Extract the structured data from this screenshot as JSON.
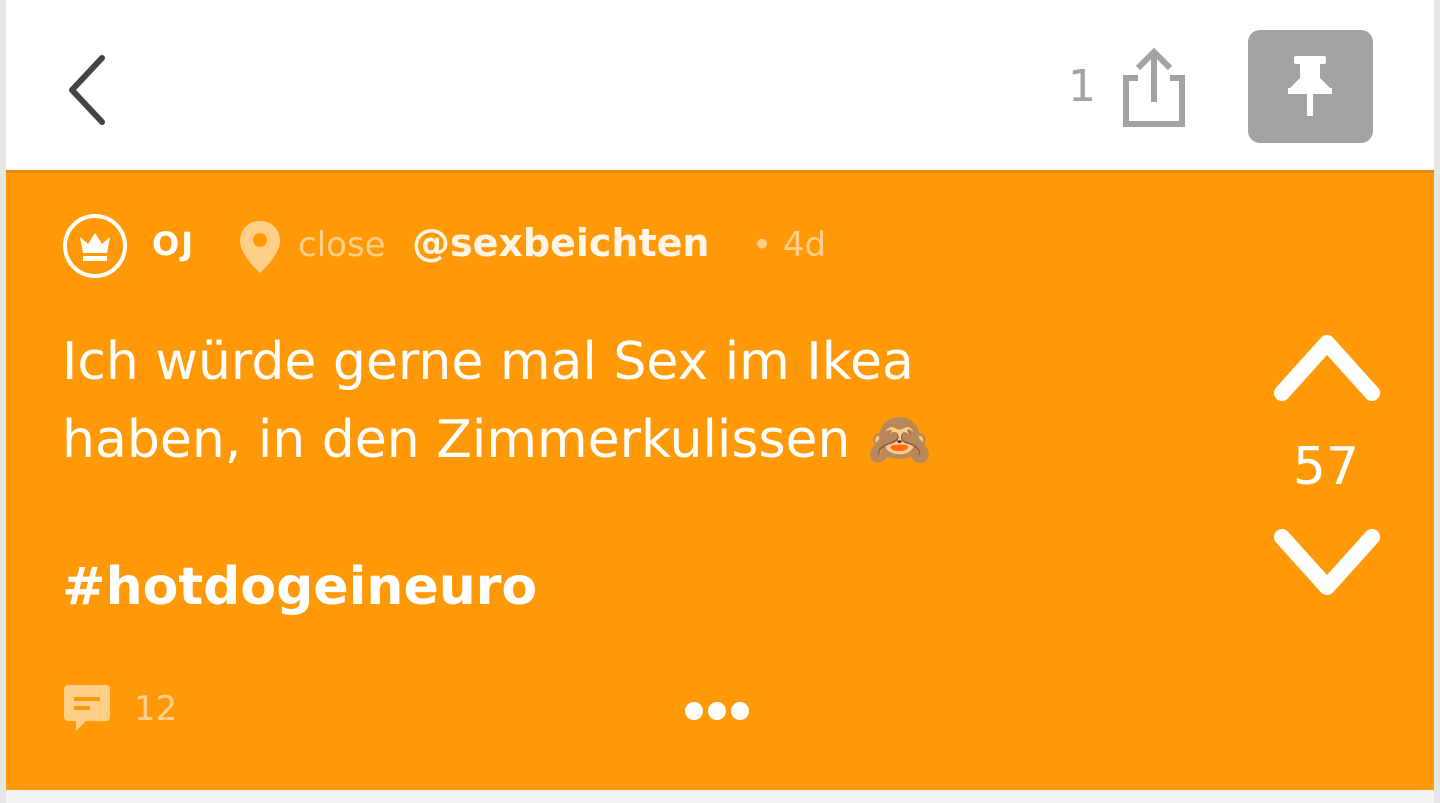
{
  "header": {
    "share_count": "1"
  },
  "post": {
    "author": "OJ",
    "location": "close",
    "channel": "@sexbeichten",
    "time": "• 4d",
    "text_line1": "Ich würde gerne mal Sex im Ikea",
    "text_line2": "haben, in den Zimmerkulissen 🙈",
    "hashtag": "#hotdogeineuro",
    "votes": "57",
    "comments": "12"
  },
  "colors": {
    "post_background": "#ff9908",
    "pin_button": "#a3a3a3",
    "muted_text": "#ffcf8a"
  },
  "icons": {
    "back": "chevron-left-icon",
    "share": "share-icon",
    "pin": "pin-icon",
    "badge": "crown-icon",
    "location": "location-pin-icon",
    "upvote": "chevron-up-icon",
    "downvote": "chevron-down-icon",
    "comment": "comment-icon",
    "more": "more-dots-icon"
  }
}
